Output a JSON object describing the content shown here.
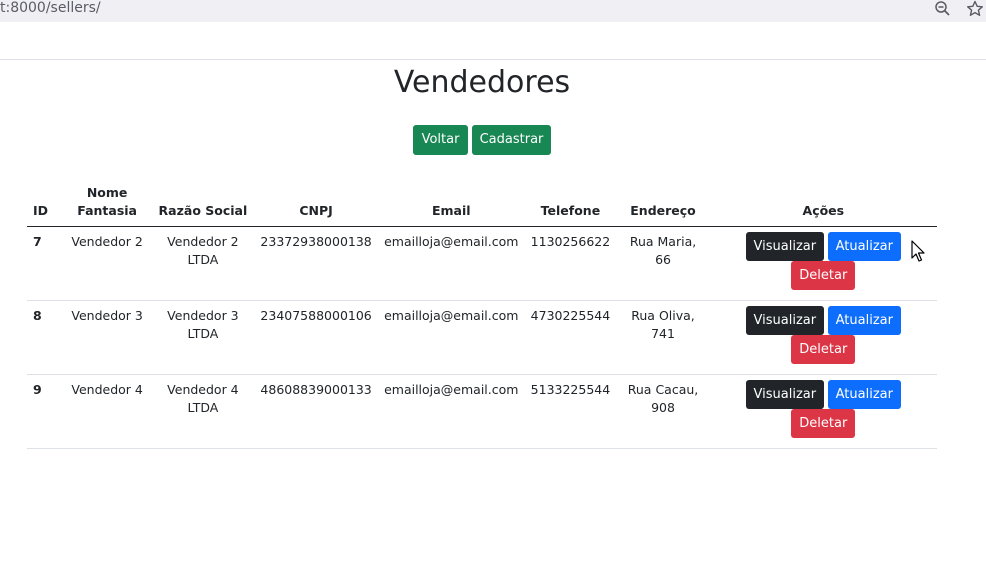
{
  "browser": {
    "url": "t:8000/sellers/",
    "zoom_icon": "zoom-out-icon",
    "bookmark_icon": "star-icon"
  },
  "page": {
    "title": "Vendedores",
    "buttons": {
      "back": "Voltar",
      "create": "Cadastrar"
    }
  },
  "table": {
    "headers": {
      "id": "ID",
      "name": "Nome Fantasia",
      "razao": "Razão Social",
      "cnpj": "CNPJ",
      "email": "Email",
      "telefone": "Telefone",
      "endereco": "Endereço",
      "acoes": "Ações"
    },
    "rows": [
      {
        "id": "7",
        "name": "Vendedor 2",
        "razao": "Vendedor 2 LTDA",
        "cnpj": "23372938000138",
        "email": "emailloja@email.com",
        "telefone": "1130256622",
        "endereco": "Rua Maria, 66"
      },
      {
        "id": "8",
        "name": "Vendedor 3",
        "razao": "Vendedor 3 LTDA",
        "cnpj": "23407588000106",
        "email": "emailloja@email.com",
        "telefone": "4730225544",
        "endereco": "Rua Oliva, 741"
      },
      {
        "id": "9",
        "name": "Vendedor 4",
        "razao": "Vendedor 4 LTDA",
        "cnpj": "48608839000133",
        "email": "emailloja@email.com",
        "telefone": "5133225544",
        "endereco": "Rua Cacau, 908"
      }
    ],
    "actions": {
      "view": "Visualizar",
      "update": "Atualizar",
      "delete": "Deletar"
    }
  },
  "colors": {
    "success": "#198754",
    "primary": "#0d6efd",
    "dark": "#212529",
    "danger": "#dc3545"
  }
}
